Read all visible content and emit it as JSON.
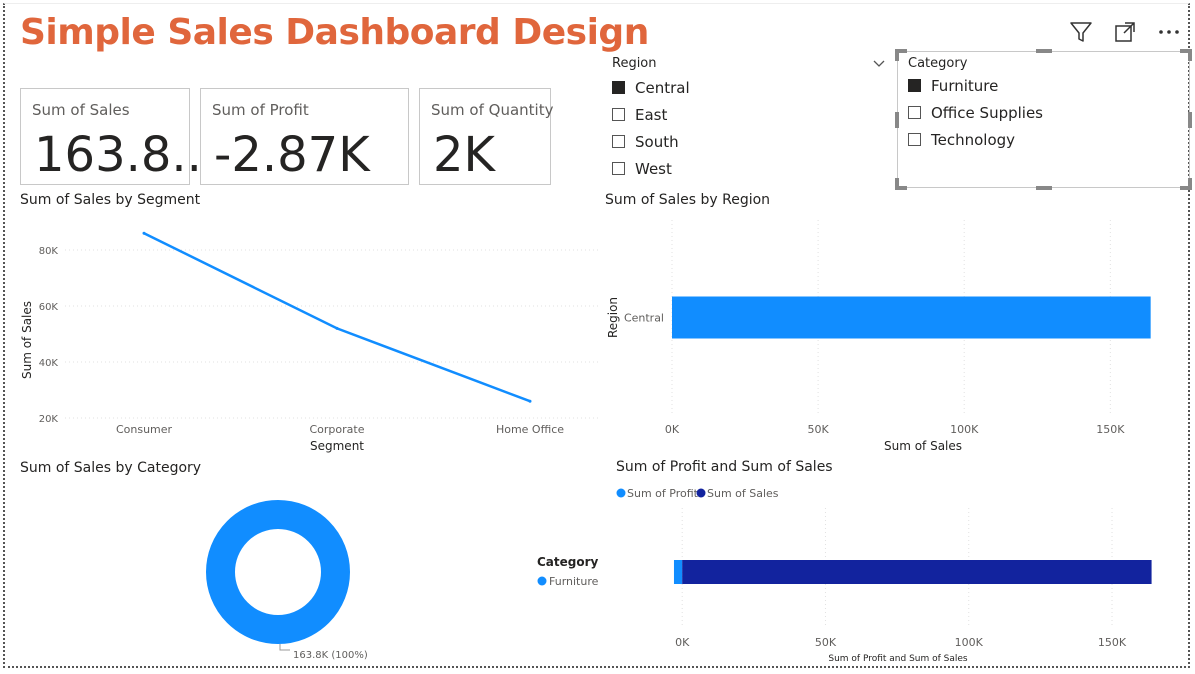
{
  "header": {
    "title": "Simple Sales Dashboard Design"
  },
  "cards": [
    {
      "label": "Sum of Sales",
      "value": "163.8..."
    },
    {
      "label": "Sum of Profit",
      "value": "-2.87K"
    },
    {
      "label": "Sum of Quantity",
      "value": "2K"
    }
  ],
  "region_slicer": {
    "title": "Region",
    "items": [
      {
        "label": "Central",
        "checked": true
      },
      {
        "label": "East",
        "checked": false
      },
      {
        "label": "South",
        "checked": false
      },
      {
        "label": "West",
        "checked": false
      }
    ]
  },
  "category_slicer": {
    "title": "Category",
    "items": [
      {
        "label": "Furniture",
        "checked": true
      },
      {
        "label": "Office Supplies",
        "checked": false
      },
      {
        "label": "Technology",
        "checked": false
      }
    ]
  },
  "icons": [
    "filter-icon",
    "focus-mode-icon",
    "more-options-icon",
    "chevron-down-icon"
  ],
  "colors": {
    "title": "#E0663C",
    "primary": "#118DFF",
    "dark": "#12239E"
  },
  "chart_data": [
    {
      "type": "line",
      "title": "Sum of Sales by Segment",
      "xlabel": "Segment",
      "ylabel": "Sum of Sales",
      "categories": [
        "Consumer",
        "Corporate",
        "Home Office"
      ],
      "values": [
        86000,
        52000,
        26000
      ],
      "yticks": [
        20000,
        40000,
        60000,
        80000
      ],
      "ytick_labels": [
        "20K",
        "40K",
        "60K",
        "80K"
      ],
      "ylim": [
        20000,
        90000
      ],
      "grid": true
    },
    {
      "type": "bar",
      "orientation": "horizontal",
      "title": "Sum of Sales by Region",
      "xlabel": "Sum of Sales",
      "ylabel": "Region",
      "categories": [
        "Central"
      ],
      "values": [
        163800
      ],
      "xticks": [
        0,
        50000,
        100000,
        150000
      ],
      "xtick_labels": [
        "0K",
        "50K",
        "100K",
        "150K"
      ],
      "xlim": [
        0,
        180000
      ],
      "grid": true
    },
    {
      "type": "pie",
      "variant": "donut",
      "title": "Sum of Sales by Category",
      "legend_title": "Category",
      "categories": [
        "Furniture"
      ],
      "values": [
        163800
      ],
      "data_labels": [
        "163.8K (100%)"
      ]
    },
    {
      "type": "bar",
      "orientation": "horizontal",
      "title": "Sum of Profit and Sum of Sales",
      "xlabel": "Sum of Profit and Sum of Sales",
      "legend_position": "top-left",
      "categories": [
        "Furniture"
      ],
      "series": [
        {
          "name": "Sum of Profit",
          "values": [
            -2870
          ]
        },
        {
          "name": "Sum of Sales",
          "values": [
            163800
          ]
        }
      ],
      "xticks": [
        0,
        50000,
        100000,
        150000
      ],
      "xtick_labels": [
        "0K",
        "50K",
        "100K",
        "150K"
      ],
      "xlim": [
        -6000,
        180000
      ],
      "grid": true
    }
  ]
}
